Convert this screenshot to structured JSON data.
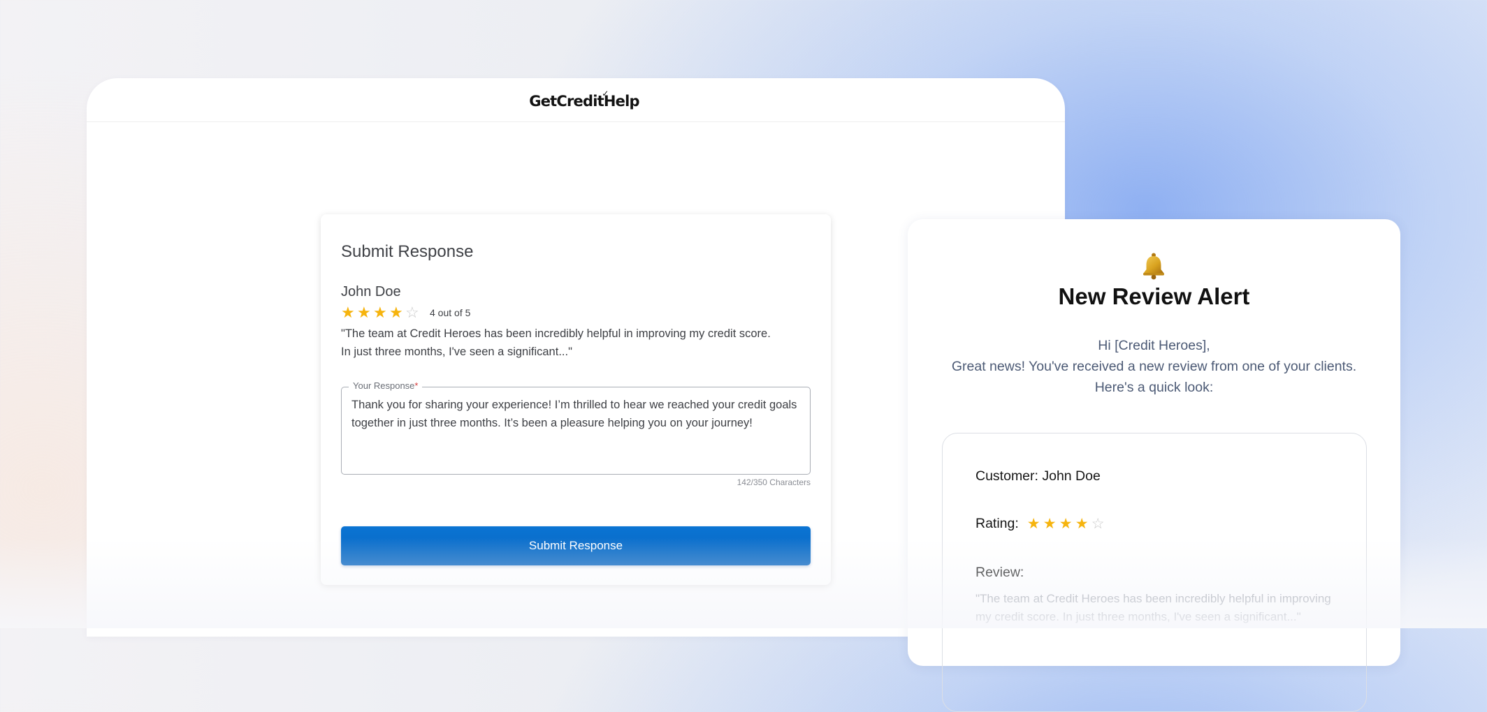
{
  "site": {
    "logo_text": "GetCreditHelp"
  },
  "response_form": {
    "title": "Submit Response",
    "reviewer_name": "John Doe",
    "rating_value": 4,
    "rating_max": 5,
    "rating_text": "4 out of 5",
    "review_excerpt_line1": "\"The team at Credit Heroes has been incredibly helpful in improving my credit score.",
    "review_excerpt_line2": "In just three months, I've seen a significant...\"",
    "field_label": "Your Response",
    "field_required_mark": "*",
    "field_value": "Thank you for sharing your experience! I’m thrilled to hear we reached your credit goals together in just three months. It’s been a pleasure helping you on your journey!",
    "char_count": "142/350 Characters",
    "submit_label": "Submit Response"
  },
  "alert_email": {
    "icon": "bell-icon",
    "title": "New Review Alert",
    "greeting": "Hi [Credit Heroes],",
    "intro_line1": "Great news! You've received a new review from one of your clients.",
    "intro_line2": "Here's a quick look:",
    "customer_label": "Customer: John Doe",
    "rating_label": "Rating:",
    "rating_value": 4,
    "rating_max": 5,
    "review_label": "Review:",
    "review_text": "\"The team at Credit Heroes has been incredibly helpful in improving my credit score. In just three months, I've seen a significant...\""
  },
  "colors": {
    "star_filled": "#f6b40e",
    "star_empty": "#c9c9c9",
    "primary_button": "#0b74d3",
    "required_mark": "#d53a3a"
  }
}
